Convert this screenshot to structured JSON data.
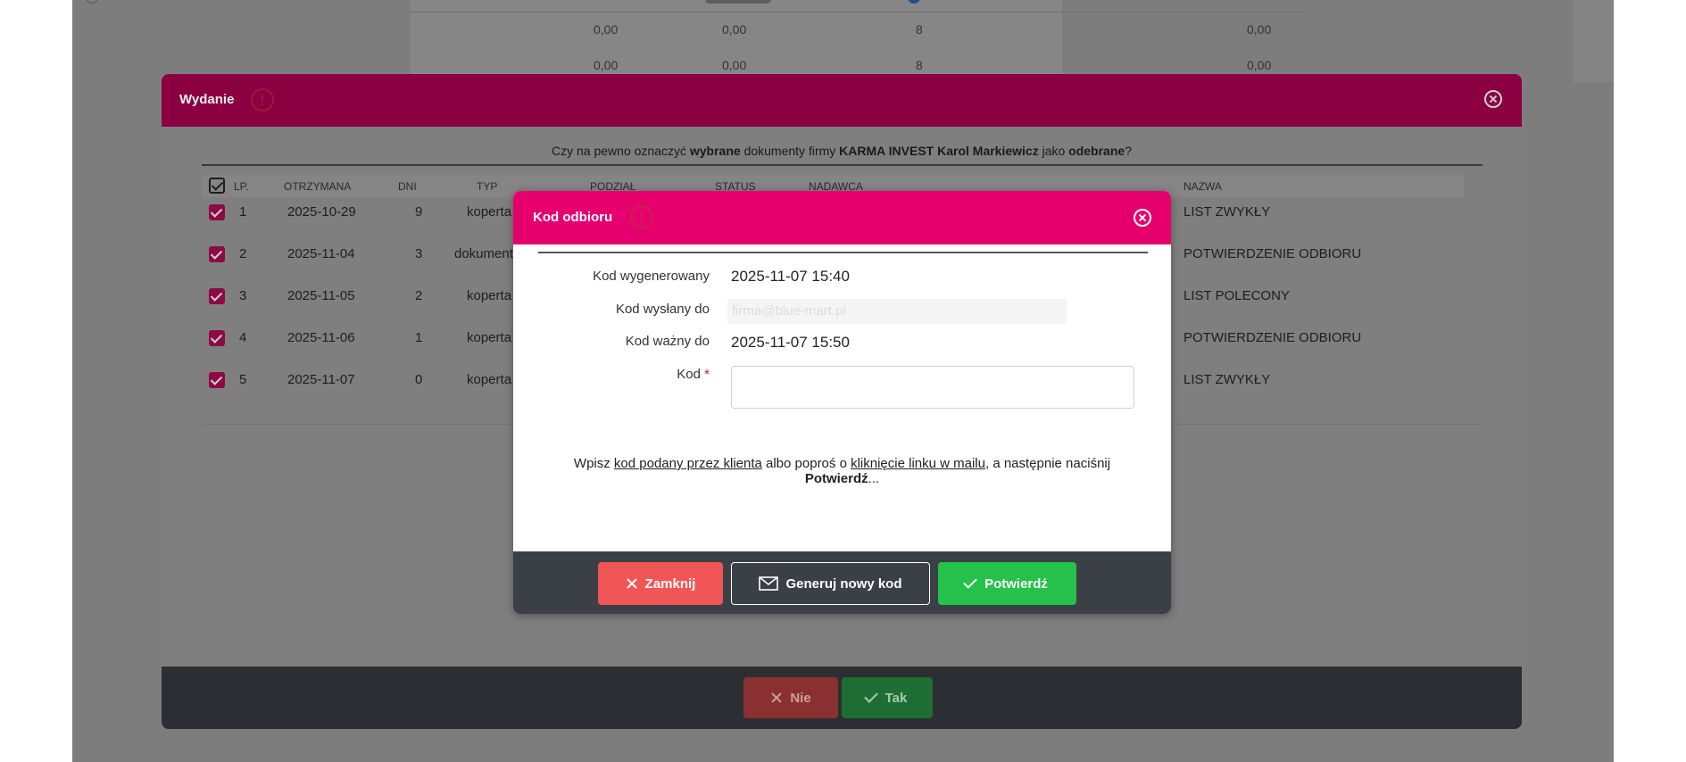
{
  "background": {
    "rows": [
      {
        "col1": "0,00",
        "col2": "0,00",
        "col3": "8",
        "col4": "0,00"
      },
      {
        "col1": "0,00",
        "col2": "0,00",
        "col3": "8",
        "col4": "0,00"
      }
    ]
  },
  "wydanie": {
    "title": "Wydanie",
    "question_prefix": "Czy na pewno oznaczyć ",
    "question_bold1": "wybrane",
    "question_mid": " dokumenty firmy ",
    "question_bold2": "KARMA INVEST Karol Markiewicz",
    "question_mid2": " jako ",
    "question_bold3": "odebrane",
    "question_suffix": "?",
    "columns": {
      "lp": "LP.",
      "otrzymana": "OTRZYMANA",
      "dni": "DNI",
      "typ": "TYP",
      "podzial": "PODZIAŁ",
      "status": "STATUS",
      "nadawca": "NADAWCA",
      "nazwa": "NAZWA"
    },
    "rows": [
      {
        "lp": "1",
        "date": "2025-10-29",
        "dni": "9",
        "typ": "koperta",
        "nazwa": "LIST ZWYKŁY"
      },
      {
        "lp": "2",
        "date": "2025-11-04",
        "dni": "3",
        "typ": "dokument",
        "nazwa": "POTWIERDZENIE ODBIORU"
      },
      {
        "lp": "3",
        "date": "2025-11-05",
        "dni": "2",
        "typ": "koperta",
        "nazwa": "LIST POLECONY"
      },
      {
        "lp": "4",
        "date": "2025-11-06",
        "dni": "1",
        "typ": "koperta",
        "nazwa": "POTWIERDZENIE ODBIORU"
      },
      {
        "lp": "5",
        "date": "2025-11-07",
        "dni": "0",
        "typ": "koperta",
        "nazwa": "LIST ZWYKŁY"
      }
    ],
    "btn_nie": "Nie",
    "btn_tak": "Tak"
  },
  "kod": {
    "title": "Kod odbioru",
    "label_generated": "Kod wygenerowany",
    "value_generated": "2025-11-07 15:40",
    "label_sent": "Kod wysłany do",
    "value_sent": "firma@blue-mart.pl",
    "label_valid": "Kod ważny do",
    "value_valid": "2025-11-07 15:50",
    "label_kod": "Kod",
    "required_mark": "*",
    "input_value": "",
    "hint_1": "Wpisz ",
    "hint_link1": "kod podany przez klienta",
    "hint_2": " albo poproś o ",
    "hint_link2": "kliknięcie linku w mailu",
    "hint_3": ", a następnie naciśnij ",
    "hint_bold": "Potwierdź",
    "hint_4": "...",
    "btn_close": "Zamknij",
    "btn_generate": "Generuj nowy kod",
    "btn_confirm": "Potwierdź"
  },
  "colors": {
    "brand_pink": "#e6006e",
    "confirm_green": "#25c14a",
    "close_red": "#f15656"
  }
}
